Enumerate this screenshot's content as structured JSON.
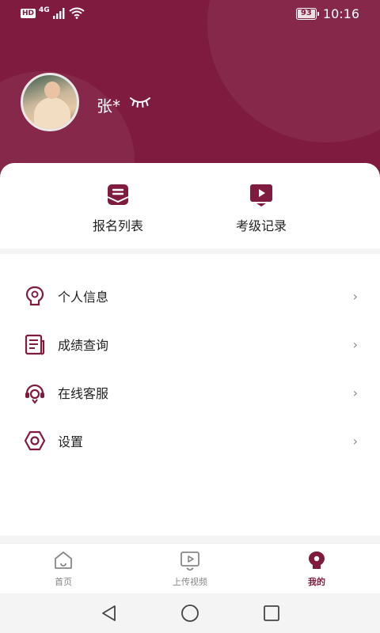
{
  "status_bar": {
    "hd": "HD",
    "network": "4G",
    "battery": "93",
    "battery_level": 0.93,
    "time": "10:16"
  },
  "profile": {
    "name": "张*",
    "visibility_icon": "eye-closed-icon"
  },
  "quick_actions": [
    {
      "label": "报名列表",
      "icon": "envelope-list-icon"
    },
    {
      "label": "考级记录",
      "icon": "video-record-icon"
    }
  ],
  "menu": [
    {
      "label": "个人信息",
      "icon": "person-info-icon"
    },
    {
      "label": "成绩查询",
      "icon": "document-icon"
    },
    {
      "label": "在线客服",
      "icon": "customer-service-icon"
    },
    {
      "label": "设置",
      "icon": "settings-hexagon-icon"
    }
  ],
  "tabs": [
    {
      "label": "首页",
      "icon": "home-icon",
      "active": false
    },
    {
      "label": "上传视频",
      "icon": "upload-video-icon",
      "active": false
    },
    {
      "label": "我的",
      "icon": "profile-icon",
      "active": true
    }
  ],
  "colors": {
    "brand": "#7f1b3f",
    "text": "#222222",
    "muted": "#888888"
  }
}
